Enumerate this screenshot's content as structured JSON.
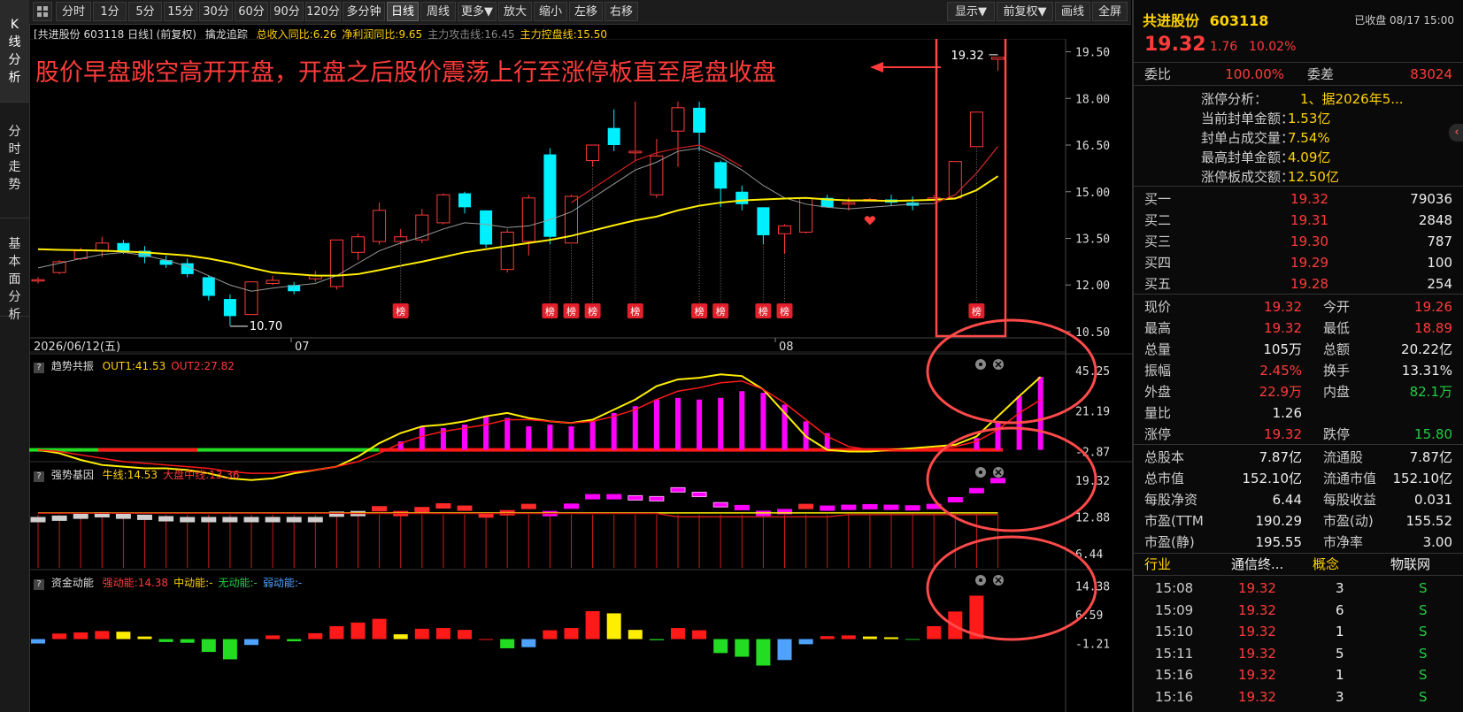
{
  "left_tabs": [
    "K线分析",
    "分时走势",
    "基本面分析"
  ],
  "toolbar": {
    "periods": [
      "分时",
      "1分",
      "5分",
      "15分",
      "30分",
      "60分",
      "90分",
      "120分",
      "多分钟",
      "日线",
      "周线",
      "更多▼",
      "放大",
      "缩小",
      "左移",
      "右移"
    ],
    "active_period": "日线",
    "right": [
      "显示▼",
      "前复权▼",
      "画线",
      "全屏"
    ]
  },
  "main_chart": {
    "info_label": "[共进股份 603118 日线]  (前复权)",
    "indicator_name": "擒龙追踪",
    "indicator_values": [
      {
        "text": "总收入同比:6.26",
        "color": "#ffd200"
      },
      {
        "text": "净利润同比:9.65",
        "color": "#ffd200"
      },
      {
        "text": "主力攻击线:16.45",
        "color": "#888888"
      },
      {
        "text": "主力控盘线:15.50",
        "color": "#ffd200"
      }
    ],
    "annotation": "股价早盘跳空高开开盘，开盘之后股价震荡上行至涨停板直至尾盘收盘",
    "high_label": "19.32",
    "low_label": "10.70",
    "list_tag": "榜",
    "date_labels": {
      "start": "2026/06/12(五)",
      "m7": "07",
      "m8": "08"
    },
    "y_ticks": [
      "19.50",
      "18.00",
      "16.50",
      "15.00",
      "13.50",
      "12.00",
      "10.50"
    ]
  },
  "sub1": {
    "name": "趋势共振",
    "vals": [
      {
        "text": "OUT1:41.53",
        "color": "#ffd200"
      },
      {
        "text": "OUT2:27.82",
        "color": "#ff3b3b"
      }
    ],
    "y_ticks": [
      "45.25",
      "21.19",
      "-2.87"
    ]
  },
  "sub2": {
    "name": "强势基因",
    "vals": [
      {
        "text": "牛线:14.53",
        "color": "#ffd200"
      },
      {
        "text": "大盘中线:13.36",
        "color": "#ff3b3b"
      }
    ],
    "y_ticks": [
      "19.32",
      "12.88",
      "6.44"
    ]
  },
  "sub3": {
    "name": "资金动能",
    "vals": [
      {
        "text": "强动能:14.38",
        "color": "#ff3b3b"
      },
      {
        "text": "中动能:-",
        "color": "#ffd200"
      },
      {
        "text": "无动能:-",
        "color": "#22cc44"
      },
      {
        "text": "弱动能:-",
        "color": "#4fa3ff"
      }
    ],
    "y_ticks": [
      "14.38",
      "6.59",
      "-1.21"
    ]
  },
  "chart_data": {
    "type": "candlestick",
    "start_date": "2026/06/12",
    "candles": [
      [
        12.17,
        12.17,
        12.05,
        12.25
      ],
      [
        12.4,
        12.75,
        12.35,
        12.8
      ],
      [
        12.85,
        13.1,
        12.8,
        13.2
      ],
      [
        13.1,
        13.35,
        12.9,
        13.55
      ],
      [
        13.35,
        13.1,
        13.0,
        13.45
      ],
      [
        13.1,
        12.9,
        12.7,
        13.25
      ],
      [
        12.8,
        12.65,
        12.55,
        12.95
      ],
      [
        12.7,
        12.35,
        12.25,
        12.85
      ],
      [
        12.25,
        11.65,
        11.5,
        12.3
      ],
      [
        11.55,
        11.0,
        10.7,
        11.7
      ],
      [
        11.05,
        12.1,
        11.05,
        12.1
      ],
      [
        12.05,
        12.15,
        12.0,
        12.3
      ],
      [
        12.0,
        11.8,
        11.7,
        12.1
      ],
      [
        12.2,
        12.3,
        12.1,
        12.45
      ],
      [
        11.95,
        13.45,
        11.85,
        13.45
      ],
      [
        13.05,
        13.55,
        12.8,
        13.65
      ],
      [
        13.4,
        14.4,
        13.3,
        14.65
      ],
      [
        13.4,
        13.55,
        13.3,
        13.8
      ],
      [
        13.45,
        14.25,
        13.35,
        14.45
      ],
      [
        14.0,
        14.9,
        13.95,
        14.95
      ],
      [
        14.95,
        14.5,
        14.3,
        15.0
      ],
      [
        14.4,
        13.3,
        13.2,
        14.4
      ],
      [
        12.5,
        13.7,
        12.4,
        13.8
      ],
      [
        13.4,
        14.8,
        12.95,
        14.9
      ],
      [
        16.2,
        13.55,
        13.3,
        16.4
      ],
      [
        13.35,
        14.85,
        13.35,
        14.9
      ],
      [
        16.0,
        16.5,
        15.8,
        16.5
      ],
      [
        17.05,
        16.5,
        16.3,
        17.65
      ],
      [
        16.25,
        16.3,
        16.0,
        17.9
      ],
      [
        14.9,
        16.15,
        14.8,
        16.7
      ],
      [
        16.95,
        17.7,
        15.8,
        17.9
      ],
      [
        17.7,
        16.9,
        16.3,
        17.9
      ],
      [
        15.95,
        15.1,
        14.5,
        16.0
      ],
      [
        15.0,
        14.6,
        14.4,
        15.2
      ],
      [
        14.5,
        13.6,
        13.3,
        14.5
      ],
      [
        13.65,
        13.9,
        13.0,
        13.95
      ],
      [
        13.7,
        14.8,
        13.65,
        14.8
      ],
      [
        14.8,
        14.5,
        14.5,
        14.9
      ],
      [
        14.6,
        14.65,
        14.4,
        14.8
      ],
      [
        14.7,
        14.75,
        14.7,
        14.8
      ],
      [
        14.75,
        14.65,
        14.55,
        14.9
      ],
      [
        14.65,
        14.55,
        14.4,
        14.85
      ],
      [
        14.8,
        14.8,
        14.7,
        14.9
      ],
      [
        14.8,
        15.97,
        14.8,
        15.97
      ],
      [
        16.45,
        17.56,
        16.45,
        17.56
      ],
      [
        19.26,
        19.32,
        18.89,
        19.32
      ]
    ],
    "ma_yellow": [
      13.15,
      13.13,
      13.12,
      13.1,
      13.08,
      13.05,
      13.0,
      12.95,
      12.85,
      12.72,
      12.55,
      12.4,
      12.35,
      12.3,
      12.3,
      12.35,
      12.48,
      12.62,
      12.75,
      12.9,
      13.05,
      13.15,
      13.25,
      13.35,
      13.45,
      13.58,
      13.75,
      13.92,
      14.08,
      14.2,
      14.4,
      14.55,
      14.65,
      14.72,
      14.75,
      14.78,
      14.8,
      14.75,
      14.72,
      14.72,
      14.7,
      14.72,
      14.74,
      14.78,
      15.05,
      15.5
    ],
    "ma_gray": [
      12.55,
      12.7,
      12.85,
      12.98,
      13.05,
      12.95,
      12.8,
      12.6,
      12.3,
      12.0,
      11.8,
      11.9,
      11.98,
      12.05,
      12.3,
      12.7,
      13.1,
      13.35,
      13.55,
      13.8,
      14.0,
      13.95,
      13.85,
      13.9,
      14.1,
      14.35,
      14.8,
      15.25,
      15.7,
      15.95,
      16.3,
      16.4,
      16.1,
      15.7,
      15.2,
      14.8,
      14.6,
      14.5,
      14.45,
      14.5,
      14.55,
      14.6,
      14.62,
      14.9,
      15.6,
      16.45
    ],
    "bang_days": [
      17,
      24,
      25,
      26,
      28,
      31,
      32,
      34,
      35,
      44
    ],
    "sub1_bars": [
      -2,
      -2,
      -2,
      -2,
      -2,
      -2,
      -2,
      -2,
      -2,
      -2,
      -2,
      -2,
      -2,
      -2,
      -2,
      -2,
      -2,
      3,
      12,
      11,
      13,
      18,
      17,
      12,
      13,
      12,
      15,
      20,
      24,
      28,
      29,
      28,
      29,
      33,
      32,
      25,
      15,
      8,
      -2,
      -2,
      -2,
      -2,
      -2,
      -2,
      5,
      14,
      30,
      41.5
    ],
    "sub1_out1": [
      -2,
      -4,
      -8,
      -11,
      -12,
      -13,
      -13,
      -14,
      -16,
      -19,
      -20,
      -19,
      -16,
      -14,
      -12,
      -6,
      2,
      8,
      12,
      13,
      15,
      18,
      20,
      17,
      15,
      14,
      16,
      22,
      28,
      36,
      40,
      41,
      43,
      42,
      34,
      20,
      6,
      -2,
      -3,
      -3,
      -2,
      -1,
      0,
      1,
      6,
      18,
      30,
      41.5
    ],
    "sub1_out2": [
      -2,
      -3,
      -5,
      -7,
      -9,
      -10,
      -11,
      -12,
      -13,
      -15,
      -16,
      -16,
      -15,
      -14,
      -12,
      -9,
      -4,
      2,
      6,
      9,
      11,
      13,
      16,
      16,
      15,
      14,
      15,
      18,
      22,
      28,
      33,
      35,
      38,
      39,
      34,
      26,
      16,
      6,
      0,
      -2,
      -2,
      -2,
      -1,
      0,
      3,
      10,
      20,
      27.8
    ],
    "sub3_bars": [
      [
        -1.2,
        "#4fa3ff"
      ],
      [
        1.5,
        "#ff1a1a"
      ],
      [
        1.8,
        "#ff1a1a"
      ],
      [
        2.2,
        "#ff1a1a"
      ],
      [
        2.0,
        "#ffee00"
      ],
      [
        0.7,
        "#ffee00"
      ],
      [
        -0.8,
        "#22dd22"
      ],
      [
        -1.0,
        "#22dd22"
      ],
      [
        -3.5,
        "#22dd22"
      ],
      [
        -5.5,
        "#22dd22"
      ],
      [
        -1.6,
        "#4fa3ff"
      ],
      [
        1.0,
        "#ff1a1a"
      ],
      [
        -0.6,
        "#22dd22"
      ],
      [
        1.6,
        "#ff1a1a"
      ],
      [
        3.5,
        "#ff1a1a"
      ],
      [
        4.5,
        "#ff1a1a"
      ],
      [
        5.5,
        "#ff1a1a"
      ],
      [
        1.3,
        "#ffee00"
      ],
      [
        2.8,
        "#ff1a1a"
      ],
      [
        3.0,
        "#ff1a1a"
      ],
      [
        2.5,
        "#ff1a1a"
      ],
      [
        0.0,
        "#ff1a1a"
      ],
      [
        -2.5,
        "#22dd22"
      ],
      [
        -2.2,
        "#4fa3ff"
      ],
      [
        2.4,
        "#ff1a1a"
      ],
      [
        3.0,
        "#ff1a1a"
      ],
      [
        7.6,
        "#ff1a1a"
      ],
      [
        7.0,
        "#ffee00"
      ],
      [
        2.5,
        "#ffee00"
      ],
      [
        -0.3,
        "#22dd22"
      ],
      [
        3.0,
        "#ff1a1a"
      ],
      [
        2.4,
        "#ff1a1a"
      ],
      [
        -3.8,
        "#22dd22"
      ],
      [
        -4.8,
        "#22dd22"
      ],
      [
        -7.2,
        "#22dd22"
      ],
      [
        -5.7,
        "#4fa3ff"
      ],
      [
        -1.4,
        "#4fa3ff"
      ],
      [
        0.8,
        "#ff1a1a"
      ],
      [
        1.0,
        "#ff1a1a"
      ],
      [
        0.7,
        "#ffee00"
      ],
      [
        0.5,
        "#ffee00"
      ],
      [
        -0.2,
        "#22dd22"
      ],
      [
        3.5,
        "#ff1a1a"
      ],
      [
        7.5,
        "#ff1a1a"
      ],
      [
        11.8,
        "#ff1a1a"
      ]
    ]
  },
  "right_panel": {
    "stock_name": "共进股份",
    "stock_code": "603118",
    "status": "已收盘 08/17 15:00",
    "price": "19.32",
    "change": "1.76",
    "change_pct": "10.02%",
    "wb_label": "委比",
    "wb_value": "100.00%",
    "wc_label": "委差",
    "wc_value": "83024",
    "limit_analysis": [
      [
        "涨停分析：",
        "1、据2026年5..."
      ],
      [
        "当前封单金额：",
        "1.53亿"
      ],
      [
        "封单占成交量：",
        "7.54%"
      ],
      [
        "最高封单金额：",
        "4.09亿"
      ],
      [
        "涨停板成交额：",
        "12.50亿"
      ]
    ],
    "buy_levels": [
      [
        "买一",
        "19.32",
        "79036"
      ],
      [
        "买二",
        "19.31",
        "2848"
      ],
      [
        "买三",
        "19.30",
        "787"
      ],
      [
        "买四",
        "19.29",
        "100"
      ],
      [
        "买五",
        "19.28",
        "254"
      ]
    ],
    "quotes": [
      [
        "现价",
        "19.32",
        "red",
        "今开",
        "19.26",
        "red"
      ],
      [
        "最高",
        "19.32",
        "red",
        "最低",
        "18.89",
        "red"
      ],
      [
        "总量",
        "105万",
        "white",
        "总额",
        "20.22亿",
        "white"
      ],
      [
        "振幅",
        "2.45%",
        "red",
        "换手",
        "13.31%",
        "white"
      ],
      [
        "外盘",
        "22.9万",
        "red",
        "内盘",
        "82.1万",
        "green"
      ],
      [
        "量比",
        "1.26",
        "white",
        "",
        "",
        ""
      ],
      [
        "涨停",
        "19.32",
        "red",
        "跌停",
        "15.80",
        "green"
      ]
    ],
    "fundamentals": [
      [
        "总股本",
        "7.87亿",
        "流通股",
        "7.87亿"
      ],
      [
        "总市值",
        "152.10亿",
        "流通市值",
        "152.10亿"
      ],
      [
        "每股净资",
        "6.44",
        "每股收益",
        "0.031"
      ],
      [
        "市盈(TTM",
        "190.29",
        "市盈(动)",
        "155.52"
      ],
      [
        "市盈(静)",
        "195.55",
        "市净率",
        "3.00"
      ]
    ],
    "industry": [
      "行业",
      "通信终...",
      "概念",
      "物联网"
    ],
    "ticks": [
      [
        "15:08",
        "19.32",
        "3",
        "S"
      ],
      [
        "15:09",
        "19.32",
        "6",
        "S"
      ],
      [
        "15:10",
        "19.32",
        "1",
        "S"
      ],
      [
        "15:11",
        "19.32",
        "5",
        "S"
      ],
      [
        "15:16",
        "19.32",
        "1",
        "S"
      ],
      [
        "15:16",
        "19.32",
        "3",
        "S"
      ]
    ]
  }
}
